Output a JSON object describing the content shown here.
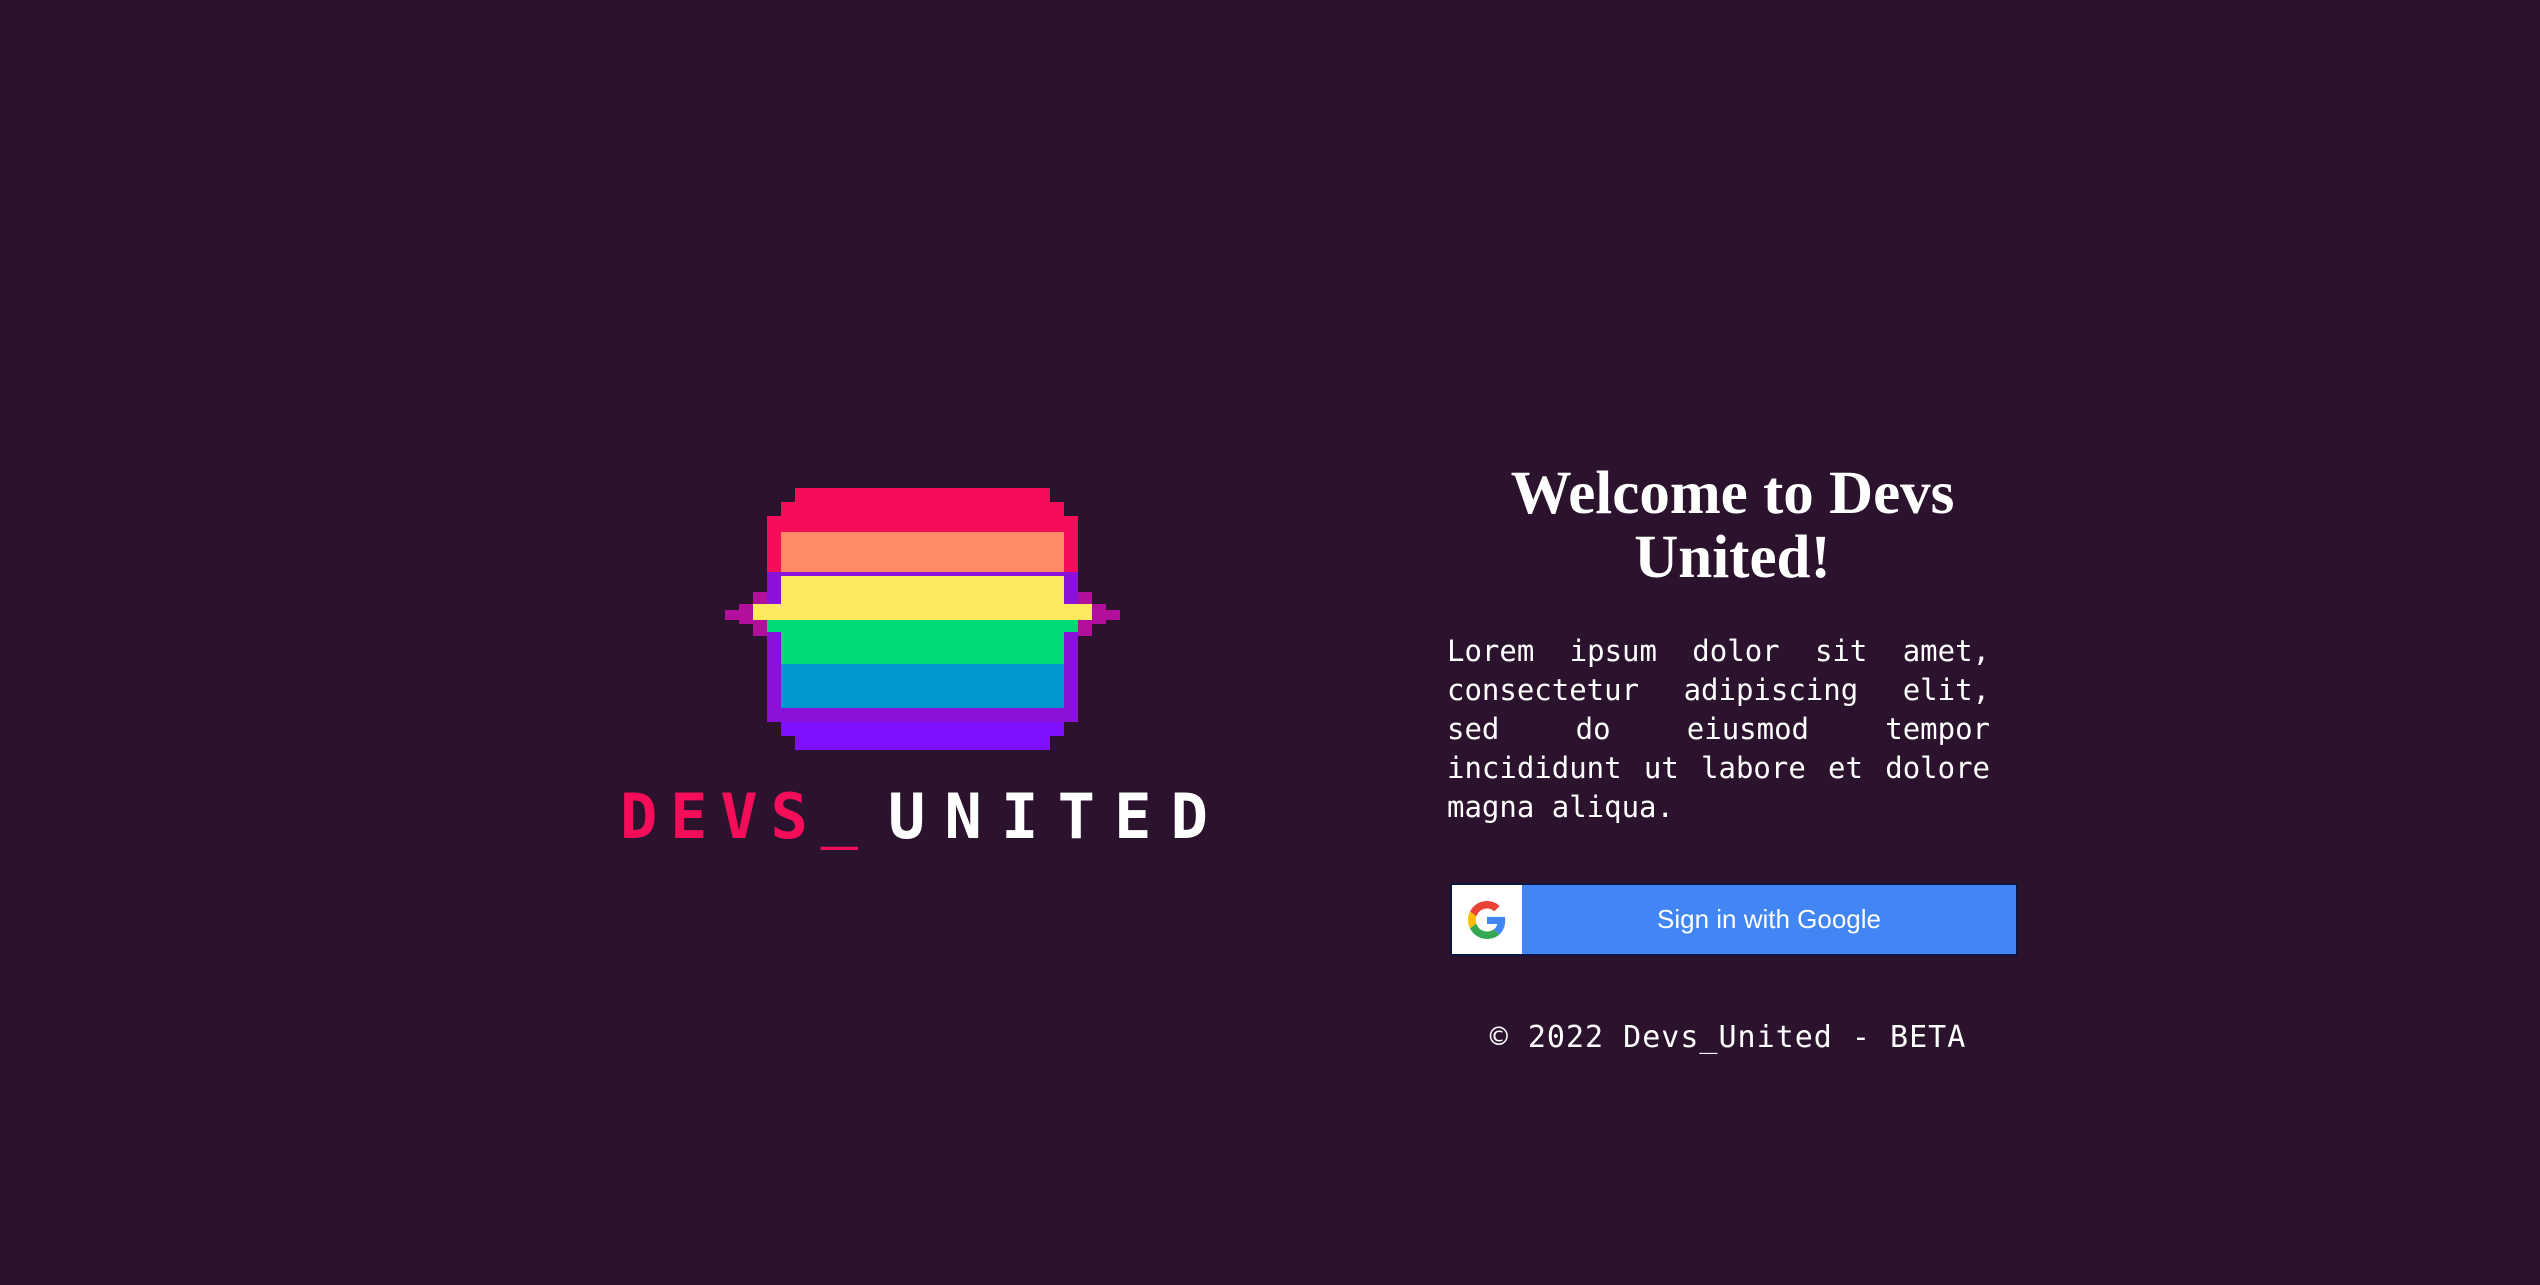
{
  "logo": {
    "icon": "pixel-rainbow-mascot-icon",
    "text_part1": "DEVS_",
    "text_part2": "UNITED",
    "colors": {
      "part1": "#f50d5a",
      "part2": "#ffffff",
      "stripes": [
        "#f50d5a",
        "#ff8a65",
        "#fee85d",
        "#00da76",
        "#0096ce",
        "#800fff"
      ]
    }
  },
  "welcome": {
    "title": "Welcome to Devs United!",
    "description": "Lorem ipsum dolor sit amet, consectetur adipiscing elit, sed do eiusmod tempor incididunt ut labore et dolore magna aliqua."
  },
  "signin": {
    "label": "Sign in with Google",
    "icon": "google-icon",
    "color": "#4285f4"
  },
  "footer": {
    "text": "© 2022 Devs_United - BETA"
  },
  "theme": {
    "background": "#2c132d"
  }
}
